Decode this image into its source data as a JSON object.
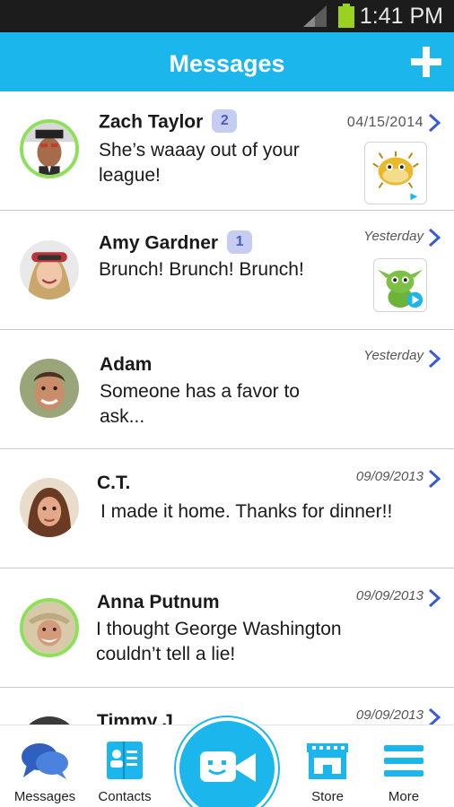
{
  "status_bar": {
    "time": "1:41 PM"
  },
  "header": {
    "title": "Messages",
    "add_icon": "plus-icon"
  },
  "colors": {
    "accent": "#1ab6ec",
    "online_ring": "#8ee05a",
    "badge_bg": "#c5cdf2",
    "chevron": "#3a5bd0"
  },
  "conversations": [
    {
      "name": "Zach Taylor",
      "badge": "2",
      "date": "04/15/2014",
      "message": "She’s waaay out of your league!",
      "online": true,
      "attachment": "pufferfish-thumbnail"
    },
    {
      "name": "Amy Gardner",
      "badge": "1",
      "date": "Yesterday",
      "message": "Brunch! Brunch! Brunch!",
      "online": false,
      "attachment": "green-creature-video-thumbnail"
    },
    {
      "name": "Adam",
      "date": "Yesterday",
      "message": "Someone has a favor to ask...",
      "online": false
    },
    {
      "name": "C.T.",
      "date": "09/09/2013",
      "message": "I made it home. Thanks for dinner!!",
      "online": false
    },
    {
      "name": "Anna Putnum",
      "date": "09/09/2013",
      "message": "I thought George Washington couldn’t tell a lie!",
      "online": true
    },
    {
      "name": "Timmy J",
      "date": "09/09/2013",
      "message": "",
      "online": false
    }
  ],
  "bottom_nav": {
    "messages": "Messages",
    "contacts": "Contacts",
    "store": "Store",
    "more": "More"
  }
}
